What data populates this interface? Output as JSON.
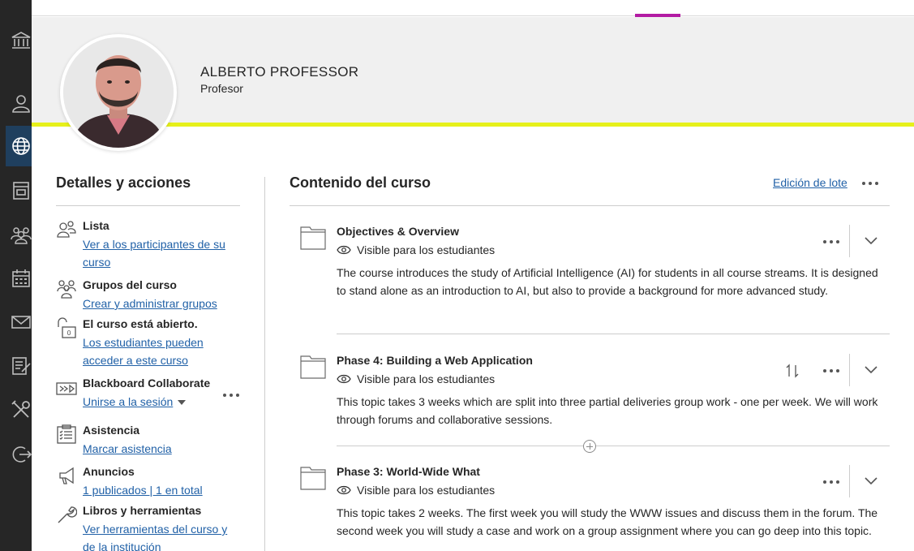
{
  "profile": {
    "name": "ALBERTO PROFESSOR",
    "role": "Profesor"
  },
  "details": {
    "title": "Detalles y acciones",
    "items": [
      {
        "icon": "roster-icon",
        "title": "Lista",
        "link": "Ver a los participantes de su curso"
      },
      {
        "icon": "groups-icon",
        "title": "Grupos del curso",
        "link": "Crear y administrar grupos"
      },
      {
        "icon": "unlock-icon",
        "title": "El curso está abierto.",
        "link": "Los estudiantes pueden acceder a este curso"
      },
      {
        "icon": "video-icon",
        "title": "Blackboard Collaborate",
        "link": "Unirse a la sesión"
      },
      {
        "icon": "clipboard-icon",
        "title": "Asistencia",
        "link": "Marcar asistencia"
      },
      {
        "icon": "megaphone-icon",
        "title": "Anuncios",
        "link": "1 publicados | 1 en total"
      },
      {
        "icon": "wrench-icon",
        "title": "Libros y herramientas",
        "link": "Ver herramientas del curso y de la institución"
      }
    ]
  },
  "content": {
    "title": "Contenido del curso",
    "batch_edit": "Edición de lote",
    "items": [
      {
        "title": "Objectives & Overview",
        "visibility": "Visible para los estudiantes",
        "description": "The course introduces the study of Artificial Intelligence (AI) for students in all course streams. It is designed to stand alone as an introduction to AI, but also to provide a background for more advanced study."
      },
      {
        "title": "Phase 4: Building a Web Application",
        "visibility": "Visible para los estudiantes",
        "description": "This topic takes 3 weeks which are split into three partial deliveries group work - one per week. We will work through forums and collaborative sessions."
      },
      {
        "title": "Phase 3: World-Wide What",
        "visibility": "Visible para los estudiantes",
        "description": "This topic takes 2 weeks. The first week you will study the WWW issues and discuss them in the forum. The second week you will study a case and work on a group assignment where you can go deep into this topic."
      }
    ]
  },
  "colors": {
    "nav_bg": "#262626",
    "accent_magenta": "#b31ba3",
    "accent_yellow": "#e6f01a",
    "link": "#2161a7"
  },
  "nav_icons": [
    "institution-icon",
    "user-icon",
    "globe-icon",
    "courses-icon",
    "groups-icon",
    "calendar-icon",
    "mail-icon",
    "grades-icon",
    "tools-icon",
    "signout-icon"
  ]
}
